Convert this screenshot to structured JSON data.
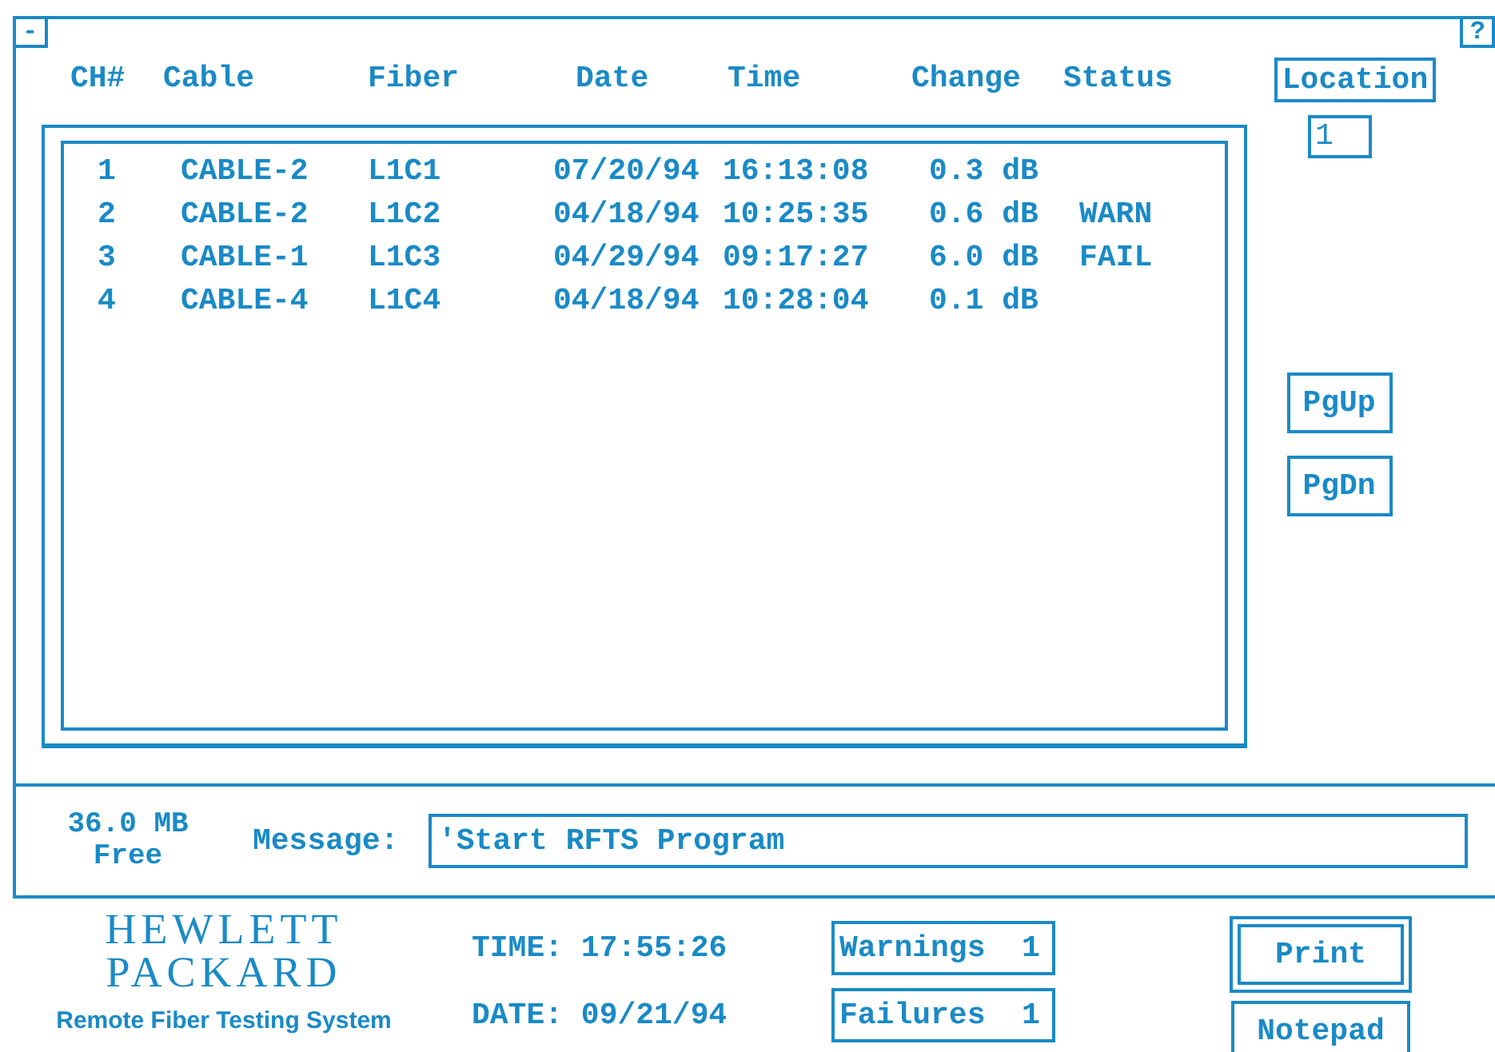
{
  "window": {
    "minimize": "-",
    "help": "?"
  },
  "columns": [
    "CH#",
    "Cable",
    "Fiber",
    "Date",
    "Time",
    "Change",
    "Status"
  ],
  "rows": [
    {
      "ch": "1",
      "cable": "CABLE-2",
      "fiber": "L1C1",
      "date": "07/20/94",
      "time": "16:13:08",
      "change": "0.3 dB"
    },
    {
      "ch": "2",
      "cable": "CABLE-2",
      "fiber": "L1C2",
      "date": "04/18/94",
      "time": "10:25:35",
      "change": "0.6 dB",
      "status": "WARN"
    },
    {
      "ch": "3",
      "cable": "CABLE-1",
      "fiber": "L1C3",
      "date": "04/29/94",
      "time": "09:17:27",
      "change": "6.0 dB",
      "status": "FAIL"
    },
    {
      "ch": "4",
      "cable": "CABLE-4",
      "fiber": "L1C4",
      "date": "04/18/94",
      "time": "10:28:04",
      "change": "0.1 dB"
    }
  ],
  "location": {
    "label": "Location",
    "value": "1"
  },
  "paging": [
    "PgUp",
    "PgDn"
  ],
  "disk": {
    "size": "36.0 MB",
    "label": "Free"
  },
  "message": {
    "label": "Message:",
    "value": "'Start RFTS Program"
  },
  "brand": {
    "line1": "HEWLETT",
    "line2": "PACKARD",
    "subtitle": "Remote Fiber Testing System"
  },
  "clock": {
    "time_label": "TIME:",
    "time": "17:55:26",
    "date_label": "DATE:",
    "date": "09/21/94"
  },
  "counters": [
    {
      "label": "Warnings",
      "value": "1"
    },
    {
      "label": "Failures",
      "value": "1"
    }
  ],
  "buttons": [
    {
      "label": "Print",
      "default": true
    },
    {
      "label": "Notepad",
      "default": false
    }
  ]
}
